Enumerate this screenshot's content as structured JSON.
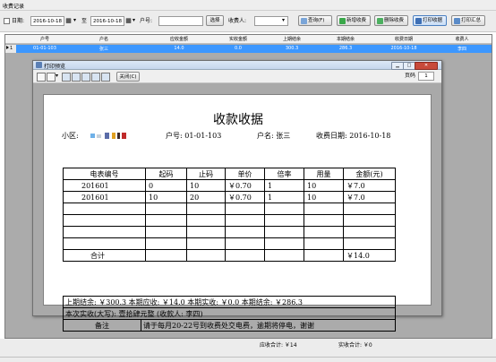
{
  "window": {
    "title": "收费记录"
  },
  "toolbar": {
    "date_label": "日期:",
    "date_from": "2016-10-18",
    "to_label": "至",
    "date_to": "2016-10-18",
    "account_label": "户号:",
    "account_value": "",
    "select_button": "选择",
    "collector_label": "收费人:",
    "collector_value": "",
    "query_button": "查询(F)",
    "new_button": "新增收费",
    "delete_button": "删除收费",
    "print_receipt_button": "打印收据",
    "print_summary_button": "打印汇总"
  },
  "grid": {
    "columns": [
      "户号",
      "户名",
      "应收金额",
      "实收金额",
      "上期结余",
      "本期结余",
      "收费日期",
      "收费人"
    ],
    "rows": [
      {
        "row_no": "1",
        "cells": [
          "01-01-103",
          "张三",
          "14.0",
          "0.0",
          "300.3",
          "286.3",
          "2016-10-18",
          "李四"
        ]
      }
    ]
  },
  "preview": {
    "title": "打印预览",
    "close_button": "关闭(C)",
    "page_label": "页码",
    "page_value": "1"
  },
  "receipt": {
    "title": "收款收据",
    "community_label": "小区:",
    "account_label": "户号:",
    "account": "01-01-103",
    "name_label": "户名:",
    "name": "张三",
    "date_label": "收费日期:",
    "date": "2016-10-18",
    "headers": [
      "电表编号",
      "起码",
      "止码",
      "单价",
      "倍率",
      "用量",
      "金额(元)"
    ],
    "rows": [
      [
        "201601",
        "0",
        "10",
        "￥0.70",
        "1",
        "10",
        "￥7.0"
      ],
      [
        "201601",
        "10",
        "20",
        "￥0.70",
        "1",
        "10",
        "￥7.0"
      ],
      [
        "",
        "",
        "",
        "",
        "",
        "",
        ""
      ],
      [
        "",
        "",
        "",
        "",
        "",
        "",
        ""
      ],
      [
        "",
        "",
        "",
        "",
        "",
        "",
        ""
      ],
      [
        "",
        "",
        "",
        "",
        "",
        "",
        ""
      ]
    ],
    "total_label": "合计",
    "total": "￥14.0",
    "summary_line": "上期结余: ￥300.3  本期应收: ￥14.0  本期实收: ￥0.0  本期结余: ￥286.3",
    "paid_line": "本次实收(大写): 壹拾肆元整 (收款人: 李四)",
    "remark_label": "备注",
    "remark": "请于每月20-22号到收费处交电费，逾期将停电，谢谢"
  },
  "status": {
    "receivable_total": "应收合计: ￥14",
    "received_total": "实收合计: ￥0"
  },
  "colors": {
    "selection": "#3c97ff",
    "background": "#ababab"
  }
}
